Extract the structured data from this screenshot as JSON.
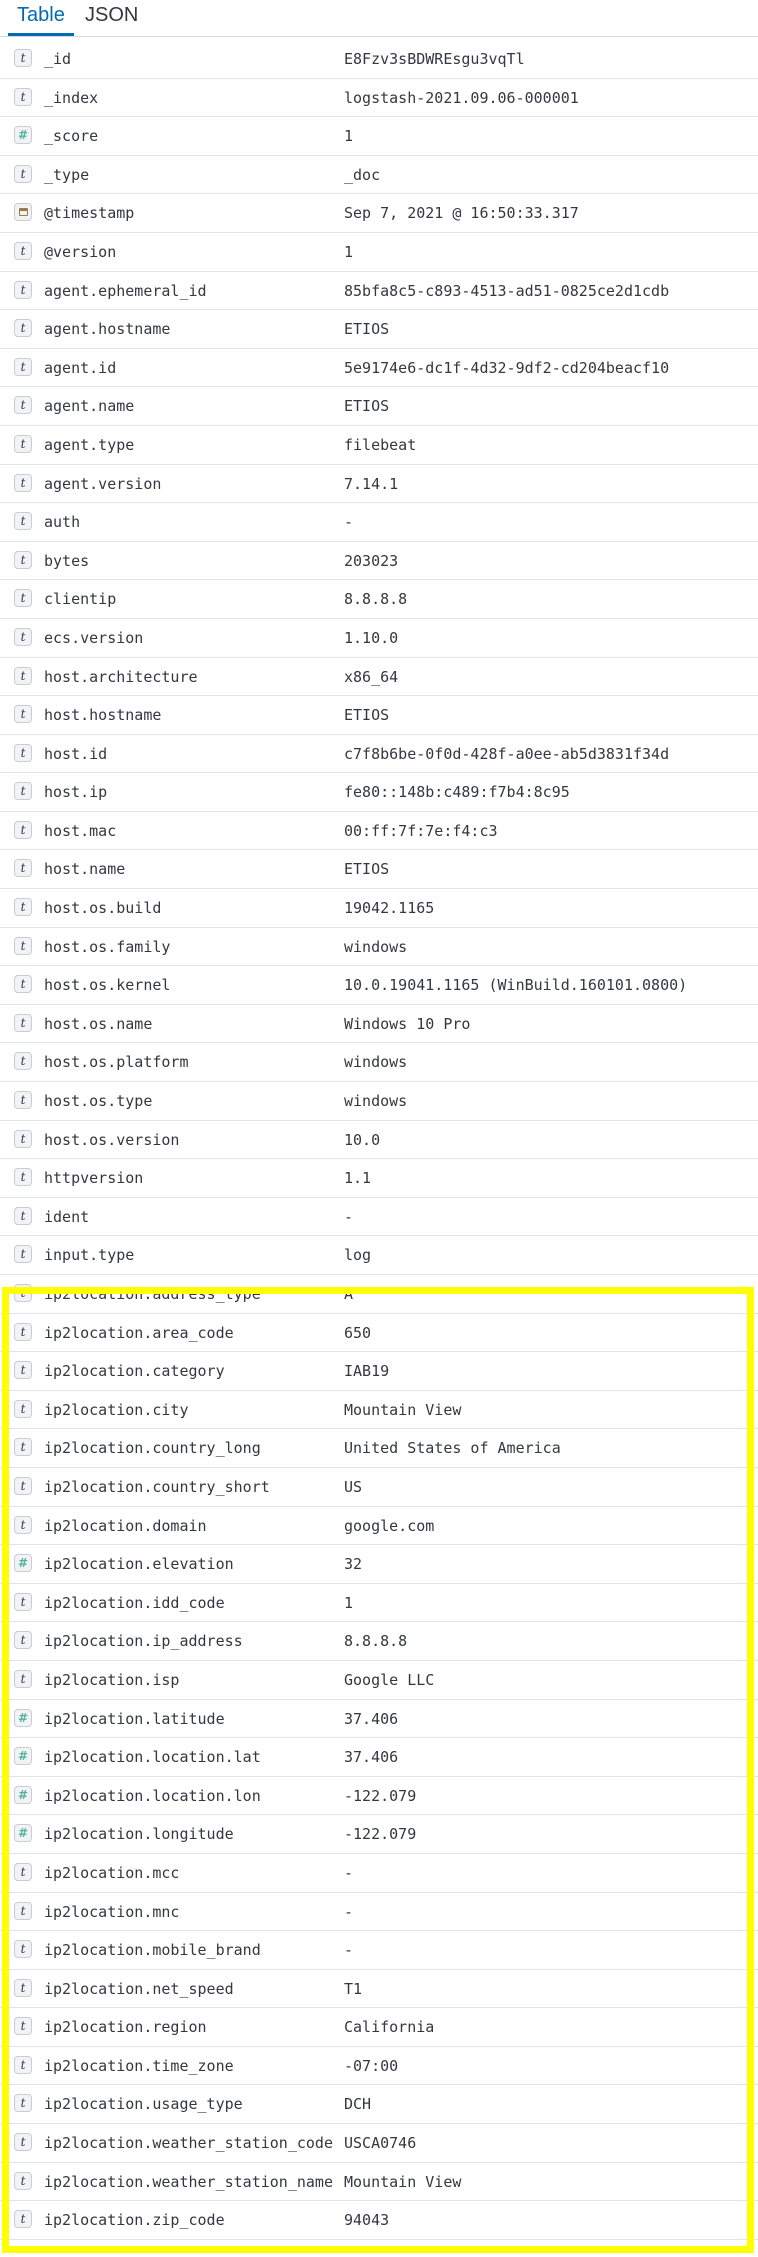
{
  "tabs": [
    {
      "label": "Table",
      "active": true
    },
    {
      "label": "JSON",
      "active": false
    }
  ],
  "colors": {
    "accent": "#006bb4",
    "number_badge": "#54b399",
    "highlight": "#ffff00",
    "row_border": "#dfe3ea"
  },
  "fields": [
    {
      "type": "string",
      "name": "_id",
      "value": "E8Fzv3sBDWREsgu3vqTl"
    },
    {
      "type": "string",
      "name": "_index",
      "value": "logstash-2021.09.06-000001"
    },
    {
      "type": "number",
      "name": "_score",
      "value": "1"
    },
    {
      "type": "string",
      "name": "_type",
      "value": "_doc"
    },
    {
      "type": "date",
      "name": "@timestamp",
      "value": "Sep 7, 2021 @ 16:50:33.317"
    },
    {
      "type": "string",
      "name": "@version",
      "value": "1"
    },
    {
      "type": "string",
      "name": "agent.ephemeral_id",
      "value": "85bfa8c5-c893-4513-ad51-0825ce2d1cdb"
    },
    {
      "type": "string",
      "name": "agent.hostname",
      "value": "ETIOS"
    },
    {
      "type": "string",
      "name": "agent.id",
      "value": "5e9174e6-dc1f-4d32-9df2-cd204beacf10"
    },
    {
      "type": "string",
      "name": "agent.name",
      "value": "ETIOS"
    },
    {
      "type": "string",
      "name": "agent.type",
      "value": "filebeat"
    },
    {
      "type": "string",
      "name": "agent.version",
      "value": "7.14.1"
    },
    {
      "type": "string",
      "name": "auth",
      "value": "-"
    },
    {
      "type": "string",
      "name": "bytes",
      "value": "203023"
    },
    {
      "type": "string",
      "name": "clientip",
      "value": "8.8.8.8"
    },
    {
      "type": "string",
      "name": "ecs.version",
      "value": "1.10.0"
    },
    {
      "type": "string",
      "name": "host.architecture",
      "value": "x86_64"
    },
    {
      "type": "string",
      "name": "host.hostname",
      "value": "ETIOS"
    },
    {
      "type": "string",
      "name": "host.id",
      "value": "c7f8b6be-0f0d-428f-a0ee-ab5d3831f34d"
    },
    {
      "type": "string",
      "name": "host.ip",
      "value": "fe80::148b:c489:f7b4:8c95"
    },
    {
      "type": "string",
      "name": "host.mac",
      "value": "00:ff:7f:7e:f4:c3"
    },
    {
      "type": "string",
      "name": "host.name",
      "value": "ETIOS"
    },
    {
      "type": "string",
      "name": "host.os.build",
      "value": "19042.1165"
    },
    {
      "type": "string",
      "name": "host.os.family",
      "value": "windows"
    },
    {
      "type": "string",
      "name": "host.os.kernel",
      "value": "10.0.19041.1165 (WinBuild.160101.0800)"
    },
    {
      "type": "string",
      "name": "host.os.name",
      "value": "Windows 10 Pro"
    },
    {
      "type": "string",
      "name": "host.os.platform",
      "value": "windows"
    },
    {
      "type": "string",
      "name": "host.os.type",
      "value": "windows"
    },
    {
      "type": "string",
      "name": "host.os.version",
      "value": "10.0"
    },
    {
      "type": "string",
      "name": "httpversion",
      "value": "1.1"
    },
    {
      "type": "string",
      "name": "ident",
      "value": "-"
    },
    {
      "type": "string",
      "name": "input.type",
      "value": "log"
    },
    {
      "type": "string",
      "name": "ip2location.address_type",
      "value": "A"
    },
    {
      "type": "string",
      "name": "ip2location.area_code",
      "value": "650"
    },
    {
      "type": "string",
      "name": "ip2location.category",
      "value": "IAB19"
    },
    {
      "type": "string",
      "name": "ip2location.city",
      "value": "Mountain View"
    },
    {
      "type": "string",
      "name": "ip2location.country_long",
      "value": "United States of America"
    },
    {
      "type": "string",
      "name": "ip2location.country_short",
      "value": "US"
    },
    {
      "type": "string",
      "name": "ip2location.domain",
      "value": "google.com"
    },
    {
      "type": "number",
      "name": "ip2location.elevation",
      "value": "32"
    },
    {
      "type": "string",
      "name": "ip2location.idd_code",
      "value": "1"
    },
    {
      "type": "string",
      "name": "ip2location.ip_address",
      "value": "8.8.8.8"
    },
    {
      "type": "string",
      "name": "ip2location.isp",
      "value": "Google LLC"
    },
    {
      "type": "number",
      "name": "ip2location.latitude",
      "value": "37.406"
    },
    {
      "type": "number",
      "name": "ip2location.location.lat",
      "value": "37.406"
    },
    {
      "type": "number",
      "name": "ip2location.location.lon",
      "value": "-122.079"
    },
    {
      "type": "number",
      "name": "ip2location.longitude",
      "value": "-122.079"
    },
    {
      "type": "string",
      "name": "ip2location.mcc",
      "value": "-"
    },
    {
      "type": "string",
      "name": "ip2location.mnc",
      "value": "-"
    },
    {
      "type": "string",
      "name": "ip2location.mobile_brand",
      "value": "-"
    },
    {
      "type": "string",
      "name": "ip2location.net_speed",
      "value": "T1"
    },
    {
      "type": "string",
      "name": "ip2location.region",
      "value": "California"
    },
    {
      "type": "string",
      "name": "ip2location.time_zone",
      "value": "-07:00"
    },
    {
      "type": "string",
      "name": "ip2location.usage_type",
      "value": "DCH"
    },
    {
      "type": "string",
      "name": "ip2location.weather_station_code",
      "value": "USCA0746"
    },
    {
      "type": "string",
      "name": "ip2location.weather_station_name",
      "value": "Mountain View"
    },
    {
      "type": "string",
      "name": "ip2location.zip_code",
      "value": "94043"
    }
  ]
}
